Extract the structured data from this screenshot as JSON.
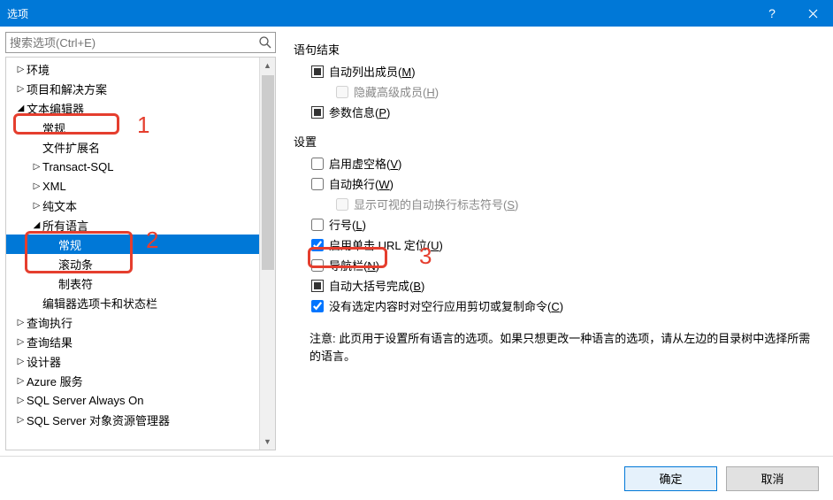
{
  "title": "选项",
  "search": {
    "placeholder": "搜索选项(Ctrl+E)"
  },
  "tree": [
    {
      "label": "环境",
      "level": 0,
      "twisty": "▷",
      "selected": false
    },
    {
      "label": "项目和解决方案",
      "level": 0,
      "twisty": "▷",
      "selected": false
    },
    {
      "label": "文本编辑器",
      "level": 0,
      "twisty": "◢",
      "selected": false
    },
    {
      "label": "常规",
      "level": 1,
      "twisty": "",
      "selected": false
    },
    {
      "label": "文件扩展名",
      "level": 1,
      "twisty": "",
      "selected": false
    },
    {
      "label": "Transact-SQL",
      "level": 1,
      "twisty": "▷",
      "selected": false
    },
    {
      "label": "XML",
      "level": 1,
      "twisty": "▷",
      "selected": false
    },
    {
      "label": "纯文本",
      "level": 1,
      "twisty": "▷",
      "selected": false
    },
    {
      "label": "所有语言",
      "level": 1,
      "twisty": "◢",
      "selected": false
    },
    {
      "label": "常规",
      "level": 2,
      "twisty": "",
      "selected": true
    },
    {
      "label": "滚动条",
      "level": 2,
      "twisty": "",
      "selected": false
    },
    {
      "label": "制表符",
      "level": 2,
      "twisty": "",
      "selected": false
    },
    {
      "label": "编辑器选项卡和状态栏",
      "level": 1,
      "twisty": "",
      "selected": false
    },
    {
      "label": "查询执行",
      "level": 0,
      "twisty": "▷",
      "selected": false
    },
    {
      "label": "查询结果",
      "level": 0,
      "twisty": "▷",
      "selected": false
    },
    {
      "label": "设计器",
      "level": 0,
      "twisty": "▷",
      "selected": false
    },
    {
      "label": "Azure 服务",
      "level": 0,
      "twisty": "▷",
      "selected": false
    },
    {
      "label": "SQL Server Always On",
      "level": 0,
      "twisty": "▷",
      "selected": false
    },
    {
      "label": "SQL Server 对象资源管理器",
      "level": 0,
      "twisty": "▷",
      "selected": false
    }
  ],
  "sections": {
    "stmt": "语句结束",
    "settings": "设置"
  },
  "opts": {
    "autolist": {
      "label": "自动列出成员(",
      "accel": "M",
      "tail": ")"
    },
    "hideadv": {
      "label": "隐藏高级成员(",
      "accel": "H",
      "tail": ")"
    },
    "paraminfo": {
      "label": "参数信息(",
      "accel": "P",
      "tail": ")"
    },
    "virtspace": {
      "label": "启用虚空格(",
      "accel": "V",
      "tail": ")"
    },
    "wordwrap": {
      "label": "自动换行(",
      "accel": "W",
      "tail": ")"
    },
    "wrapglyph": {
      "label": "显示可视的自动换行标志符号(",
      "accel": "S",
      "tail": ")"
    },
    "lineno": {
      "label": "行号(",
      "accel": "L",
      "tail": ")"
    },
    "singleurl": {
      "label": "启用单击 URL 定位(",
      "accel": "U",
      "tail": ")"
    },
    "navbar": {
      "label": "导航栏(",
      "accel": "N",
      "tail": ")"
    },
    "brace": {
      "label": "自动大括号完成(",
      "accel": "B",
      "tail": ")"
    },
    "cutblank": {
      "label": "没有选定内容时对空行应用剪切或复制命令(",
      "accel": "C",
      "tail": ")"
    }
  },
  "note": "注意: 此页用于设置所有语言的选项。如果只想更改一种语言的选项，请从左边的目录树中选择所需的语言。",
  "buttons": {
    "ok": "确定",
    "cancel": "取消"
  },
  "annotations": {
    "n1": "1",
    "n2": "2",
    "n3": "3"
  }
}
